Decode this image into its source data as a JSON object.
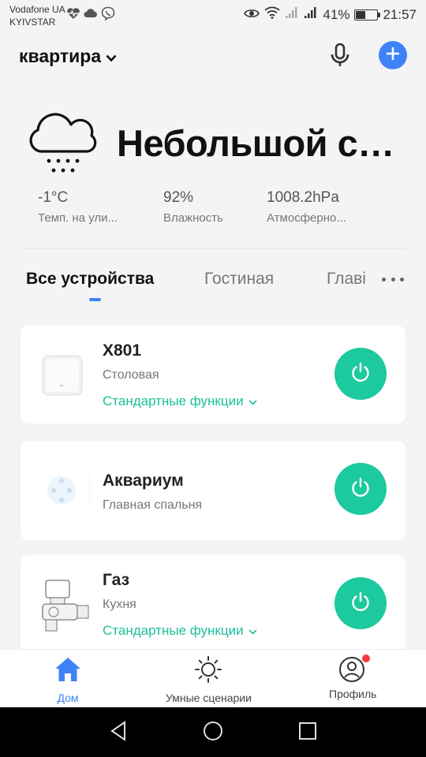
{
  "status_bar": {
    "carrier_line1": "Vodafone UA",
    "carrier_line2": "KYIVSTAR",
    "battery_percent": "41%",
    "battery_level": 0.41,
    "time": "21:57",
    "left_icons": [
      "heart-pulse-icon",
      "cloud-icon",
      "viber-icon"
    ],
    "right_icons": [
      "eye-icon",
      "wifi-icon",
      "signal-icon",
      "signal-icon",
      "battery-icon"
    ]
  },
  "header": {
    "home_name": "квартира"
  },
  "weather": {
    "condition": "Небольшой сн...",
    "icon": "snow-cloud-icon",
    "stats": [
      {
        "value": "-1°C",
        "label": "Темп. на ули..."
      },
      {
        "value": "92%",
        "label": "Влажность"
      },
      {
        "value": "1008.2hPa",
        "label": "Атмосферно..."
      }
    ]
  },
  "tabs": {
    "items": [
      "Все устройства",
      "Гостиная",
      "Главі"
    ],
    "active_index": 0
  },
  "devices": [
    {
      "name": "X801",
      "room": "Столовая",
      "functions_label": "Стандартные функции"
    },
    {
      "name": "Аквариум",
      "room": "Главная спальня"
    },
    {
      "name": "Газ",
      "room": "Кухня",
      "functions_label": "Стандартные функции"
    }
  ],
  "bottom_nav": [
    {
      "label": "Дом",
      "icon": "home-icon"
    },
    {
      "label": "Умные сценарии",
      "icon": "sun-icon"
    },
    {
      "label": "Профиль",
      "icon": "profile-icon"
    }
  ],
  "colors": {
    "accent_blue": "#3e82f7",
    "power_green": "#1dc99e",
    "function_green": "#1dc09a",
    "badge_red": "#f2393f"
  }
}
